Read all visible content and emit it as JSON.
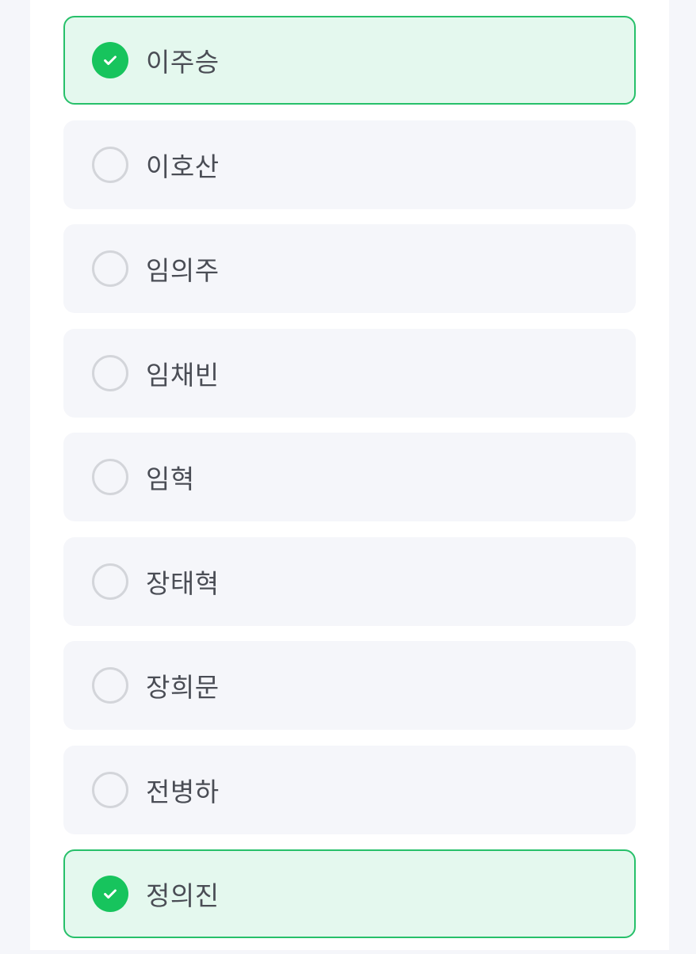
{
  "options": [
    {
      "label": "이주승",
      "selected": true
    },
    {
      "label": "이호산",
      "selected": false
    },
    {
      "label": "임의주",
      "selected": false
    },
    {
      "label": "임채빈",
      "selected": false
    },
    {
      "label": "임혁",
      "selected": false
    },
    {
      "label": "장태혁",
      "selected": false
    },
    {
      "label": "장희문",
      "selected": false
    },
    {
      "label": "전병하",
      "selected": false
    },
    {
      "label": "정의진",
      "selected": true
    }
  ],
  "colors": {
    "selected_border": "#27c06a",
    "selected_background": "#e4f8ee",
    "check_fill": "#17c45d",
    "unselected_background": "#f5f6fa",
    "radio_border": "#d3d5da"
  }
}
